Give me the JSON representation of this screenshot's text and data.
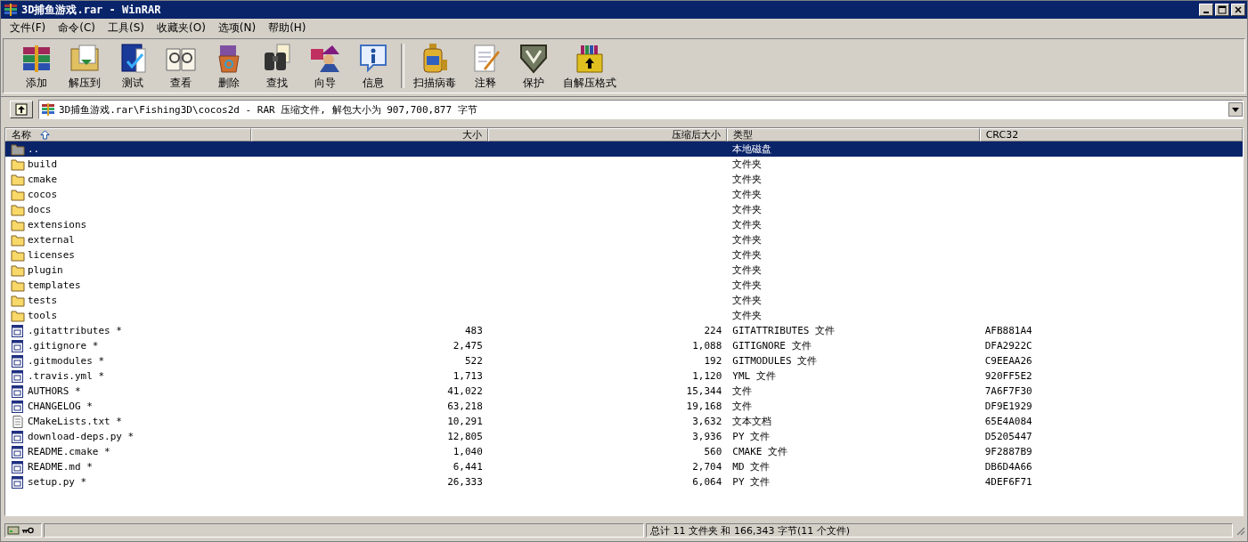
{
  "window": {
    "title": "3D捕鱼游戏.rar - WinRAR"
  },
  "menu": [
    {
      "label": "文件(F)"
    },
    {
      "label": "命令(C)"
    },
    {
      "label": "工具(S)"
    },
    {
      "label": "收藏夹(O)"
    },
    {
      "label": "选项(N)"
    },
    {
      "label": "帮助(H)"
    }
  ],
  "toolbar": {
    "groups": [
      [
        "添加",
        "解压到",
        "测试",
        "查看",
        "删除",
        "查找",
        "向导",
        "信息"
      ],
      [
        "扫描病毒",
        "注释",
        "保护",
        "自解压格式"
      ]
    ]
  },
  "address": {
    "value": "3D捕鱼游戏.rar\\Fishing3D\\cocos2d - RAR 压缩文件, 解包大小为 907,700,877 字节"
  },
  "table": {
    "columns": [
      {
        "label": "名称",
        "sorted": true
      },
      {
        "label": "大小",
        "sorted": false
      },
      {
        "label": "压缩后大小",
        "sorted": false
      },
      {
        "label": "类型",
        "sorted": false
      },
      {
        "label": "CRC32",
        "sorted": false
      }
    ],
    "rows": [
      {
        "kind": "parent",
        "name": "..",
        "size": "",
        "packed": "",
        "type": "本地磁盘",
        "crc": "",
        "selected": true
      },
      {
        "kind": "folder",
        "name": "build",
        "size": "",
        "packed": "",
        "type": "文件夹",
        "crc": "",
        "selected": false
      },
      {
        "kind": "folder",
        "name": "cmake",
        "size": "",
        "packed": "",
        "type": "文件夹",
        "crc": "",
        "selected": false
      },
      {
        "kind": "folder",
        "name": "cocos",
        "size": "",
        "packed": "",
        "type": "文件夹",
        "crc": "",
        "selected": false
      },
      {
        "kind": "folder",
        "name": "docs",
        "size": "",
        "packed": "",
        "type": "文件夹",
        "crc": "",
        "selected": false
      },
      {
        "kind": "folder",
        "name": "extensions",
        "size": "",
        "packed": "",
        "type": "文件夹",
        "crc": "",
        "selected": false
      },
      {
        "kind": "folder",
        "name": "external",
        "size": "",
        "packed": "",
        "type": "文件夹",
        "crc": "",
        "selected": false
      },
      {
        "kind": "folder",
        "name": "licenses",
        "size": "",
        "packed": "",
        "type": "文件夹",
        "crc": "",
        "selected": false
      },
      {
        "kind": "folder",
        "name": "plugin",
        "size": "",
        "packed": "",
        "type": "文件夹",
        "crc": "",
        "selected": false
      },
      {
        "kind": "folder",
        "name": "templates",
        "size": "",
        "packed": "",
        "type": "文件夹",
        "crc": "",
        "selected": false
      },
      {
        "kind": "folder",
        "name": "tests",
        "size": "",
        "packed": "",
        "type": "文件夹",
        "crc": "",
        "selected": false
      },
      {
        "kind": "folder",
        "name": "tools",
        "size": "",
        "packed": "",
        "type": "文件夹",
        "crc": "",
        "selected": false
      },
      {
        "kind": "file",
        "name": ".gitattributes *",
        "size": "483",
        "packed": "224",
        "type": "GITATTRIBUTES 文件",
        "crc": "AFB881A4",
        "selected": false
      },
      {
        "kind": "file",
        "name": ".gitignore *",
        "size": "2,475",
        "packed": "1,088",
        "type": "GITIGNORE 文件",
        "crc": "DFA2922C",
        "selected": false
      },
      {
        "kind": "file",
        "name": ".gitmodules *",
        "size": "522",
        "packed": "192",
        "type": "GITMODULES 文件",
        "crc": "C9EEAA26",
        "selected": false
      },
      {
        "kind": "file",
        "name": ".travis.yml *",
        "size": "1,713",
        "packed": "1,120",
        "type": "YML 文件",
        "crc": "920FF5E2",
        "selected": false
      },
      {
        "kind": "file",
        "name": "AUTHORS *",
        "size": "41,022",
        "packed": "15,344",
        "type": "文件",
        "crc": "7A6F7F30",
        "selected": false
      },
      {
        "kind": "file",
        "name": "CHANGELOG *",
        "size": "63,218",
        "packed": "19,168",
        "type": "文件",
        "crc": "DF9E1929",
        "selected": false
      },
      {
        "kind": "text",
        "name": "CMakeLists.txt *",
        "size": "10,291",
        "packed": "3,632",
        "type": "文本文档",
        "crc": "65E4A084",
        "selected": false
      },
      {
        "kind": "file",
        "name": "download-deps.py *",
        "size": "12,805",
        "packed": "3,936",
        "type": "PY 文件",
        "crc": "D5205447",
        "selected": false
      },
      {
        "kind": "file",
        "name": "README.cmake *",
        "size": "1,040",
        "packed": "560",
        "type": "CMAKE 文件",
        "crc": "9F2887B9",
        "selected": false
      },
      {
        "kind": "file",
        "name": "README.md *",
        "size": "6,441",
        "packed": "2,704",
        "type": "MD 文件",
        "crc": "DB6D4A66",
        "selected": false
      },
      {
        "kind": "file",
        "name": "setup.py *",
        "size": "26,333",
        "packed": "6,064",
        "type": "PY 文件",
        "crc": "4DEF6F71",
        "selected": false
      }
    ]
  },
  "status_bar": {
    "summary": "总计 11 文件夹 和 166,343 字节(11 个文件)"
  }
}
